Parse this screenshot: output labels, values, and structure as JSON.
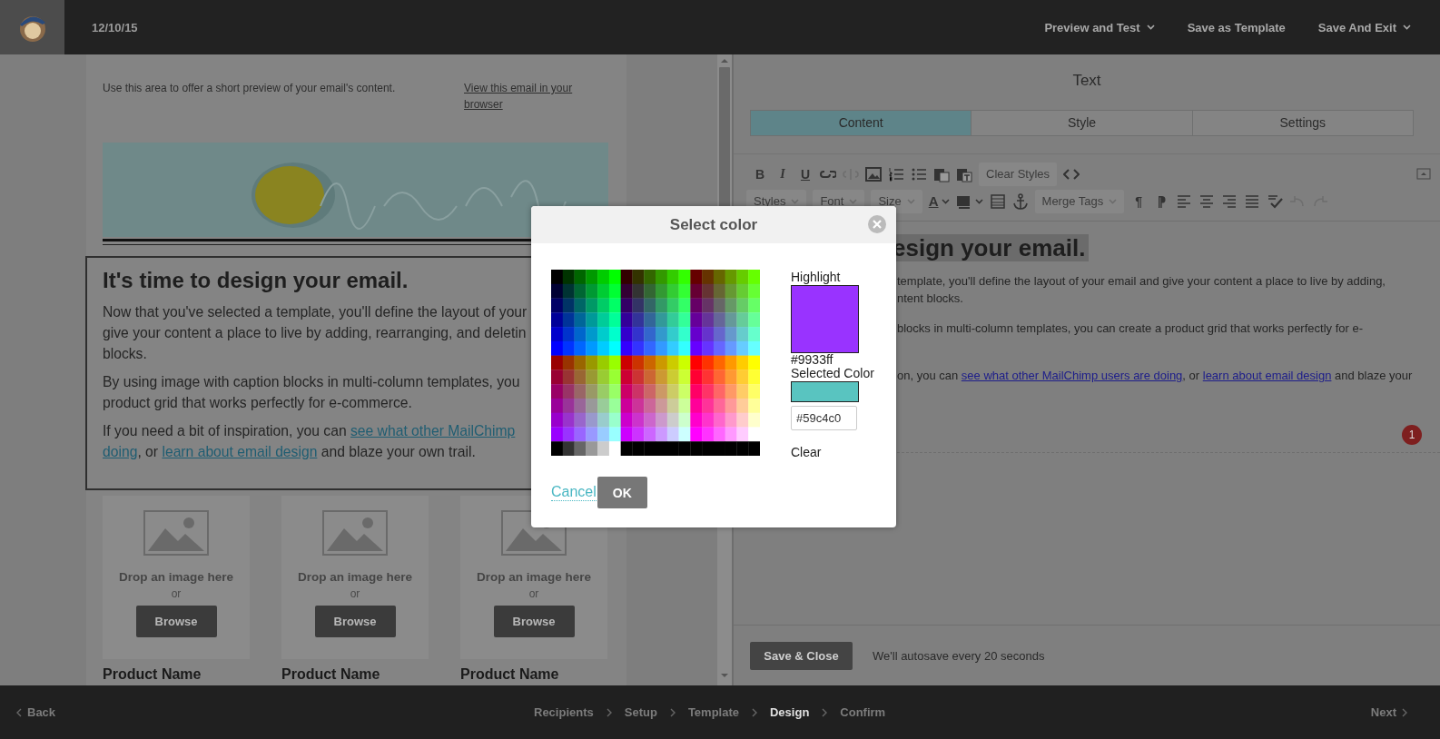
{
  "top_bar": {
    "date": "12/10/15",
    "actions": [
      {
        "label": "Preview and Test",
        "dropdown": true
      },
      {
        "label": "Save as Template",
        "dropdown": false
      },
      {
        "label": "Save And Exit",
        "dropdown": true
      }
    ]
  },
  "email": {
    "preheader": "Use this area to offer a short preview of your email's content.",
    "view_link": "View this email in your browser",
    "text_block": {
      "heading": "It's time to design your email.",
      "paragraphs": [
        [
          [
            {
              "kind": "text",
              "text": "Now that you've selected a template, you'll define the layout of your"
            }
          ],
          [
            {
              "kind": "text",
              "text": "give your content a place to live by adding, rearranging, and deletin"
            }
          ],
          [
            {
              "kind": "text",
              "text": "blocks."
            }
          ]
        ],
        [
          [
            {
              "kind": "text",
              "text": "By using image with caption blocks in multi-column templates, you"
            }
          ],
          [
            {
              "kind": "text",
              "text": "product grid that works perfectly for e-commerce."
            }
          ]
        ],
        [
          [
            {
              "kind": "text",
              "text": "If you need a bit of inspiration, you can "
            },
            {
              "kind": "link",
              "text": "see what other MailChimp"
            }
          ],
          [
            {
              "kind": "link",
              "text": "doing"
            },
            {
              "kind": "text",
              "text": ", or "
            },
            {
              "kind": "link",
              "text": "learn about email design"
            },
            {
              "kind": "text",
              "text": " and blaze your own trail."
            }
          ]
        ]
      ]
    },
    "products": [
      {
        "drop_text": "Drop an image here",
        "or": "or",
        "button": "Browse",
        "name": "Product Name"
      },
      {
        "drop_text": "Drop an image here",
        "or": "or",
        "button": "Browse",
        "name": "Product Name"
      },
      {
        "drop_text": "Drop an image here",
        "or": "or",
        "button": "Browse",
        "name": "Product Name"
      }
    ]
  },
  "editor": {
    "title": "Text",
    "tabs": [
      {
        "label": "Content",
        "selected": true
      },
      {
        "label": "Style",
        "selected": false
      },
      {
        "label": "Settings",
        "selected": false
      }
    ],
    "toolbar": {
      "bold": "B",
      "italic": "I",
      "underline": "U",
      "clear_styles": "Clear Styles",
      "styles": "Styles",
      "font": "Font",
      "size": "Size",
      "text_color": "A",
      "merge_tags": "Merge Tags",
      "ltr": "¶",
      "rtl": "⁋"
    },
    "heading": "esign your email.",
    "paragraphs": [
      [
        [
          {
            "kind": "text",
            "text": "template, you'll define the layout of your email and give your content a place to live by adding,"
          }
        ],
        [
          {
            "kind": "text",
            "text": "ntent blocks."
          }
        ]
      ],
      [
        [
          {
            "kind": "text",
            "text": " blocks in multi-column templates, you can create a product grid that works perfectly for e-"
          }
        ]
      ],
      [
        [
          {
            "kind": "text",
            "text": "on, you can "
          },
          {
            "kind": "link",
            "text": "see what other MailChimp users are doing"
          },
          {
            "kind": "text",
            "text": ", or "
          },
          {
            "kind": "link",
            "text": "learn about email design"
          },
          {
            "kind": "text",
            "text": " and blaze your"
          }
        ]
      ]
    ],
    "badge": "1",
    "save_button": "Save & Close",
    "autosave_note": "We'll autosave every 20 seconds"
  },
  "dialog": {
    "title": "Select color",
    "highlight": {
      "label": "Highlight",
      "color": "#9933ff",
      "hex": "#9933ff"
    },
    "selected": {
      "label": "Selected Color",
      "color": "#59c4c0",
      "value": "#59c4c0"
    },
    "clear": "Clear",
    "cancel": "Cancel",
    "ok": "OK"
  },
  "footer": {
    "back": "Back",
    "steps": [
      {
        "label": "Recipients",
        "selected": false
      },
      {
        "label": "Setup",
        "selected": false
      },
      {
        "label": "Template",
        "selected": false
      },
      {
        "label": "Design",
        "selected": true
      },
      {
        "label": "Confirm",
        "selected": false
      }
    ],
    "next": "Next"
  }
}
